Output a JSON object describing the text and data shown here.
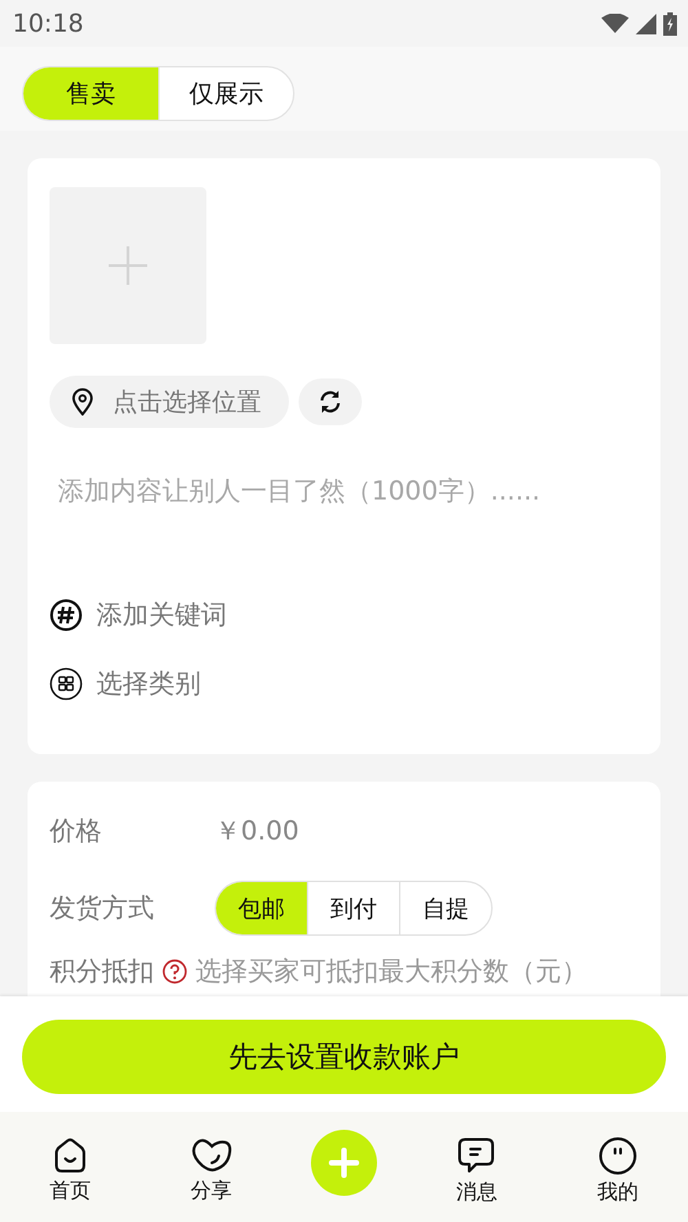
{
  "status_bar": {
    "time": "10:18"
  },
  "mode_tabs": [
    {
      "label": "售卖",
      "selected": true
    },
    {
      "label": "仅展示",
      "selected": false
    }
  ],
  "post": {
    "location": "点击选择位置",
    "description": {
      "placeholder": "添加内容让别人一目了然（1000字）......"
    },
    "options": [
      {
        "kind": "keyword",
        "label": "添加关键词"
      },
      {
        "kind": "category",
        "label": "选择类别"
      }
    ]
  },
  "details": {
    "price": {
      "label": "价格",
      "value": "￥0.00"
    },
    "shipping": {
      "label": "发货方式",
      "options": [
        {
          "label": "包邮",
          "selected": true
        },
        {
          "label": "到付",
          "selected": false
        },
        {
          "label": "自提",
          "selected": false
        }
      ]
    },
    "points": {
      "label": "积分抵扣",
      "hint": "选择买家可抵扣最大积分数（元）"
    }
  },
  "submit_button": "先去设置收款账户",
  "bottom_nav": [
    {
      "kind": "home",
      "label": "首页"
    },
    {
      "kind": "share",
      "label": "分享"
    },
    {
      "kind": "add"
    },
    {
      "kind": "message",
      "label": "消息"
    },
    {
      "kind": "profile",
      "label": "我的"
    }
  ]
}
